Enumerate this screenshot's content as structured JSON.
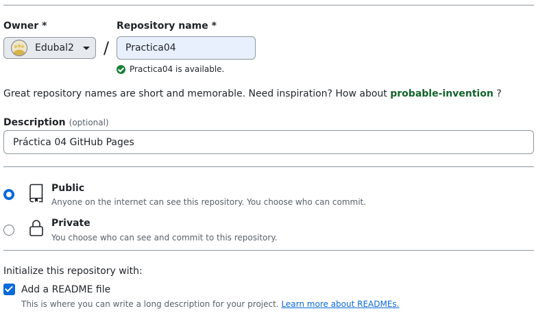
{
  "owner": {
    "label": "Owner *",
    "selected": "Edubal2",
    "avatar_icon": "user-avatar"
  },
  "repository": {
    "label": "Repository name *",
    "separator": "/",
    "value": "Practica04",
    "availability": "Practica04 is available."
  },
  "inspiration": {
    "text": "Great repository names are short and memorable. Need inspiration? How about ",
    "suggestion": "probable-invention",
    "suffix": " ?"
  },
  "description": {
    "label": "Description",
    "optional": "(optional)",
    "value": "Práctica 04 GitHub Pages"
  },
  "visibility": {
    "selected": "public",
    "options": [
      {
        "id": "public",
        "title": "Public",
        "desc": "Anyone on the internet can see this repository. You choose who can commit.",
        "icon": "repo-icon"
      },
      {
        "id": "private",
        "title": "Private",
        "desc": "You choose who can see and commit to this repository.",
        "icon": "lock-icon"
      }
    ]
  },
  "initialize": {
    "heading": "Initialize this repository with:",
    "readme": {
      "label": "Add a README file",
      "checked": true,
      "desc": "This is where you can write a long description for your project. ",
      "link": "Learn more about READMEs."
    }
  },
  "colors": {
    "accent": "#0969da",
    "success": "#1a7f37",
    "suggestion": "#116329",
    "input_autofill_bg": "#e8f0fe"
  }
}
